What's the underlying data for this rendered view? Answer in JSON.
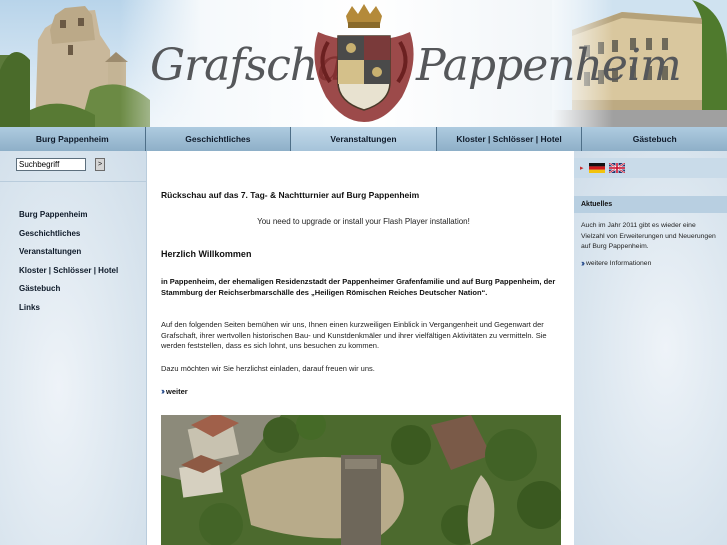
{
  "header": {
    "logo_left": "Grafschaft",
    "logo_right": "Pappenheim"
  },
  "nav": {
    "items": [
      {
        "label": "Burg Pappenheim"
      },
      {
        "label": "Geschichtliches"
      },
      {
        "label": "Veranstaltungen"
      },
      {
        "label": "Kloster | Schlösser | Hotel"
      },
      {
        "label": "Gästebuch"
      }
    ]
  },
  "search": {
    "value": "Suchbegriff",
    "button_label": ">"
  },
  "sidebar": {
    "items": [
      {
        "label": "Burg Pappenheim"
      },
      {
        "label": "Geschichtliches"
      },
      {
        "label": "Veranstaltungen"
      },
      {
        "label": "Kloster | Schlösser | Hotel"
      },
      {
        "label": "Gästebuch"
      },
      {
        "label": "Links"
      }
    ]
  },
  "main": {
    "title": "Rückschau auf das 7. Tag- & Nachtturnier auf Burg Pappenheim",
    "flash_notice": "You need to upgrade or install your Flash Player installation!",
    "welcome": "Herzlich Willkommen",
    "intro_bold": "in Pappenheim, der ehemaligen Residenzstadt der Pappenheimer Grafenfamilie und auf Burg Pappenheim, der Stammburg der Reichserbmarschälle des „Heiligen Römischen Reiches Deutscher Nation“.",
    "paragraph": "Auf den folgenden Seiten bemühen wir uns, Ihnen einen kurzweiligen Einblick in Vergangenheit und Gegenwart der Grafschaft, ihrer wertvollen historischen Bau- und Kunstdenkmäler und ihrer vielfältigen Aktivitäten zu vermitteln. Sie werden feststellen, dass es sich lohnt, uns besuchen zu kommen.",
    "invite": "Dazu möchten wir Sie herzlichst einladen, darauf freuen wir uns.",
    "more_label": "weiter"
  },
  "right": {
    "news_heading": "Aktuelles",
    "news_text": "Auch im Jahr 2011 gibt es wieder eine Vielzahl von Erweiterungen und Neuerungen auf Burg Pappenheim.",
    "more_info_label": "weitere Informationen"
  }
}
